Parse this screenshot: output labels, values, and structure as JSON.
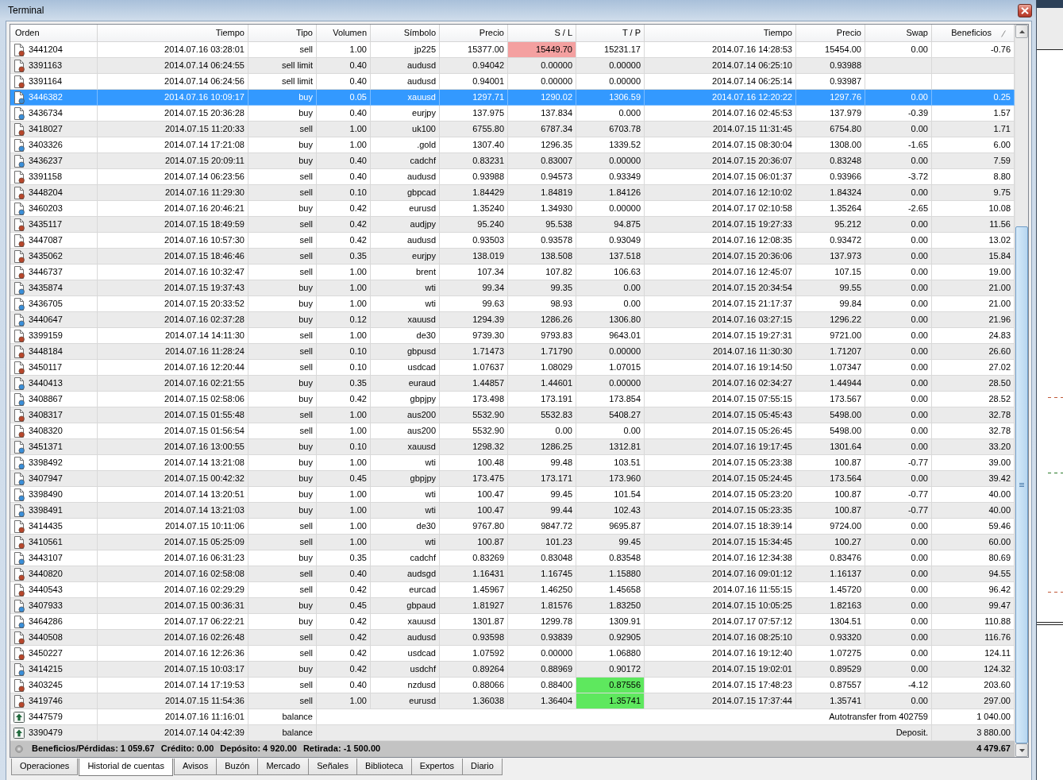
{
  "window": {
    "title": "Terminal"
  },
  "table": {
    "columns": [
      {
        "label": "Orden",
        "sorted": false
      },
      {
        "label": "Tiempo",
        "sorted": false
      },
      {
        "label": "Tipo",
        "sorted": false
      },
      {
        "label": "Volumen",
        "sorted": false
      },
      {
        "label": "Símbolo",
        "sorted": false
      },
      {
        "label": "Precio",
        "sorted": false
      },
      {
        "label": "S / L",
        "sorted": false
      },
      {
        "label": "T / P",
        "sorted": false
      },
      {
        "label": "Tiempo",
        "sorted": false
      },
      {
        "label": "Precio",
        "sorted": false
      },
      {
        "label": "Swap",
        "sorted": false
      },
      {
        "label": "Beneficios",
        "sorted": true
      }
    ],
    "rows": [
      {
        "kind": "sell",
        "selected": false,
        "order": "3441204",
        "open_time": "2014.07.16 03:28:01",
        "type": "sell",
        "volume": "1.00",
        "symbol": "jp225",
        "open_price": "15377.00",
        "sl": "15449.70",
        "sl_hit": true,
        "tp": "15231.17",
        "tp_hit": false,
        "close_time": "2014.07.16 14:28:53",
        "close_price": "15454.00",
        "swap": "0.00",
        "profit": "-0.76"
      },
      {
        "kind": "sell",
        "selected": false,
        "order": "3391163",
        "open_time": "2014.07.14 06:24:55",
        "type": "sell limit",
        "volume": "0.40",
        "symbol": "audusd",
        "open_price": "0.94042",
        "sl": "0.00000",
        "sl_hit": false,
        "tp": "0.00000",
        "tp_hit": false,
        "close_time": "2014.07.14 06:25:10",
        "close_price": "0.93988"
      },
      {
        "kind": "sell",
        "selected": false,
        "order": "3391164",
        "open_time": "2014.07.14 06:24:56",
        "type": "sell limit",
        "volume": "0.40",
        "symbol": "audusd",
        "open_price": "0.94001",
        "sl": "0.00000",
        "sl_hit": false,
        "tp": "0.00000",
        "tp_hit": false,
        "close_time": "2014.07.14 06:25:14",
        "close_price": "0.93987"
      },
      {
        "kind": "buy",
        "selected": true,
        "order": "3446382",
        "open_time": "2014.07.16 10:09:17",
        "type": "buy",
        "volume": "0.05",
        "symbol": "xauusd",
        "open_price": "1297.71",
        "sl": "1290.02",
        "sl_hit": false,
        "tp": "1306.59",
        "tp_hit": false,
        "close_time": "2014.07.16 12:20:22",
        "close_price": "1297.76",
        "swap": "0.00",
        "profit": "0.25"
      },
      {
        "kind": "buy",
        "selected": false,
        "order": "3436734",
        "open_time": "2014.07.15 20:36:28",
        "type": "buy",
        "volume": "0.40",
        "symbol": "eurjpy",
        "open_price": "137.975",
        "sl": "137.834",
        "sl_hit": false,
        "tp": "0.000",
        "tp_hit": false,
        "close_time": "2014.07.16 02:45:53",
        "close_price": "137.979",
        "swap": "-0.39",
        "profit": "1.57"
      },
      {
        "kind": "sell",
        "selected": false,
        "order": "3418027",
        "open_time": "2014.07.15 11:20:33",
        "type": "sell",
        "volume": "1.00",
        "symbol": "uk100",
        "open_price": "6755.80",
        "sl": "6787.34",
        "sl_hit": false,
        "tp": "6703.78",
        "tp_hit": false,
        "close_time": "2014.07.15 11:31:45",
        "close_price": "6754.80",
        "swap": "0.00",
        "profit": "1.71"
      },
      {
        "kind": "buy",
        "selected": false,
        "order": "3403326",
        "open_time": "2014.07.14 17:21:08",
        "type": "buy",
        "volume": "1.00",
        "symbol": ".gold",
        "open_price": "1307.40",
        "sl": "1296.35",
        "sl_hit": false,
        "tp": "1339.52",
        "tp_hit": false,
        "close_time": "2014.07.15 08:30:04",
        "close_price": "1308.00",
        "swap": "-1.65",
        "profit": "6.00"
      },
      {
        "kind": "buy",
        "selected": false,
        "order": "3436237",
        "open_time": "2014.07.15 20:09:11",
        "type": "buy",
        "volume": "0.40",
        "symbol": "cadchf",
        "open_price": "0.83231",
        "sl": "0.83007",
        "sl_hit": false,
        "tp": "0.00000",
        "tp_hit": false,
        "close_time": "2014.07.15 20:36:07",
        "close_price": "0.83248",
        "swap": "0.00",
        "profit": "7.59"
      },
      {
        "kind": "sell",
        "selected": false,
        "order": "3391158",
        "open_time": "2014.07.14 06:23:56",
        "type": "sell",
        "volume": "0.40",
        "symbol": "audusd",
        "open_price": "0.93988",
        "sl": "0.94573",
        "sl_hit": false,
        "tp": "0.93349",
        "tp_hit": false,
        "close_time": "2014.07.15 06:01:37",
        "close_price": "0.93966",
        "swap": "-3.72",
        "profit": "8.80"
      },
      {
        "kind": "sell",
        "selected": false,
        "order": "3448204",
        "open_time": "2014.07.16 11:29:30",
        "type": "sell",
        "volume": "0.10",
        "symbol": "gbpcad",
        "open_price": "1.84429",
        "sl": "1.84819",
        "sl_hit": false,
        "tp": "1.84126",
        "tp_hit": false,
        "close_time": "2014.07.16 12:10:02",
        "close_price": "1.84324",
        "swap": "0.00",
        "profit": "9.75"
      },
      {
        "kind": "buy",
        "selected": false,
        "order": "3460203",
        "open_time": "2014.07.16 20:46:21",
        "type": "buy",
        "volume": "0.42",
        "symbol": "eurusd",
        "open_price": "1.35240",
        "sl": "1.34930",
        "sl_hit": false,
        "tp": "0.00000",
        "tp_hit": false,
        "close_time": "2014.07.17 02:10:58",
        "close_price": "1.35264",
        "swap": "-2.65",
        "profit": "10.08"
      },
      {
        "kind": "sell",
        "selected": false,
        "order": "3435117",
        "open_time": "2014.07.15 18:49:59",
        "type": "sell",
        "volume": "0.42",
        "symbol": "audjpy",
        "open_price": "95.240",
        "sl": "95.538",
        "sl_hit": false,
        "tp": "94.875",
        "tp_hit": false,
        "close_time": "2014.07.15 19:27:33",
        "close_price": "95.212",
        "swap": "0.00",
        "profit": "11.56"
      },
      {
        "kind": "sell",
        "selected": false,
        "order": "3447087",
        "open_time": "2014.07.16 10:57:30",
        "type": "sell",
        "volume": "0.42",
        "symbol": "audusd",
        "open_price": "0.93503",
        "sl": "0.93578",
        "sl_hit": false,
        "tp": "0.93049",
        "tp_hit": false,
        "close_time": "2014.07.16 12:08:35",
        "close_price": "0.93472",
        "swap": "0.00",
        "profit": "13.02"
      },
      {
        "kind": "sell",
        "selected": false,
        "order": "3435062",
        "open_time": "2014.07.15 18:46:46",
        "type": "sell",
        "volume": "0.35",
        "symbol": "eurjpy",
        "open_price": "138.019",
        "sl": "138.508",
        "sl_hit": false,
        "tp": "137.518",
        "tp_hit": false,
        "close_time": "2014.07.15 20:36:06",
        "close_price": "137.973",
        "swap": "0.00",
        "profit": "15.84"
      },
      {
        "kind": "sell",
        "selected": false,
        "order": "3446737",
        "open_time": "2014.07.16 10:32:47",
        "type": "sell",
        "volume": "1.00",
        "symbol": "brent",
        "open_price": "107.34",
        "sl": "107.82",
        "sl_hit": false,
        "tp": "106.63",
        "tp_hit": false,
        "close_time": "2014.07.16 12:45:07",
        "close_price": "107.15",
        "swap": "0.00",
        "profit": "19.00"
      },
      {
        "kind": "buy",
        "selected": false,
        "order": "3435874",
        "open_time": "2014.07.15 19:37:43",
        "type": "buy",
        "volume": "1.00",
        "symbol": "wti",
        "open_price": "99.34",
        "sl": "99.35",
        "sl_hit": false,
        "tp": "0.00",
        "tp_hit": false,
        "close_time": "2014.07.15 20:34:54",
        "close_price": "99.55",
        "swap": "0.00",
        "profit": "21.00"
      },
      {
        "kind": "buy",
        "selected": false,
        "order": "3436705",
        "open_time": "2014.07.15 20:33:52",
        "type": "buy",
        "volume": "1.00",
        "symbol": "wti",
        "open_price": "99.63",
        "sl": "98.93",
        "sl_hit": false,
        "tp": "0.00",
        "tp_hit": false,
        "close_time": "2014.07.15 21:17:37",
        "close_price": "99.84",
        "swap": "0.00",
        "profit": "21.00"
      },
      {
        "kind": "buy",
        "selected": false,
        "order": "3440647",
        "open_time": "2014.07.16 02:37:28",
        "type": "buy",
        "volume": "0.12",
        "symbol": "xauusd",
        "open_price": "1294.39",
        "sl": "1286.26",
        "sl_hit": false,
        "tp": "1306.80",
        "tp_hit": false,
        "close_time": "2014.07.16 03:27:15",
        "close_price": "1296.22",
        "swap": "0.00",
        "profit": "21.96"
      },
      {
        "kind": "sell",
        "selected": false,
        "order": "3399159",
        "open_time": "2014.07.14 14:11:30",
        "type": "sell",
        "volume": "1.00",
        "symbol": "de30",
        "open_price": "9739.30",
        "sl": "9793.83",
        "sl_hit": false,
        "tp": "9643.01",
        "tp_hit": false,
        "close_time": "2014.07.15 19:27:31",
        "close_price": "9721.00",
        "swap": "0.00",
        "profit": "24.83"
      },
      {
        "kind": "sell",
        "selected": false,
        "order": "3448184",
        "open_time": "2014.07.16 11:28:24",
        "type": "sell",
        "volume": "0.10",
        "symbol": "gbpusd",
        "open_price": "1.71473",
        "sl": "1.71790",
        "sl_hit": false,
        "tp": "0.00000",
        "tp_hit": false,
        "close_time": "2014.07.16 11:30:30",
        "close_price": "1.71207",
        "swap": "0.00",
        "profit": "26.60"
      },
      {
        "kind": "sell",
        "selected": false,
        "order": "3450117",
        "open_time": "2014.07.16 12:20:44",
        "type": "sell",
        "volume": "0.10",
        "symbol": "usdcad",
        "open_price": "1.07637",
        "sl": "1.08029",
        "sl_hit": false,
        "tp": "1.07015",
        "tp_hit": false,
        "close_time": "2014.07.16 19:14:50",
        "close_price": "1.07347",
        "swap": "0.00",
        "profit": "27.02"
      },
      {
        "kind": "buy",
        "selected": false,
        "order": "3440413",
        "open_time": "2014.07.16 02:21:55",
        "type": "buy",
        "volume": "0.35",
        "symbol": "euraud",
        "open_price": "1.44857",
        "sl": "1.44601",
        "sl_hit": false,
        "tp": "0.00000",
        "tp_hit": false,
        "close_time": "2014.07.16 02:34:27",
        "close_price": "1.44944",
        "swap": "0.00",
        "profit": "28.50"
      },
      {
        "kind": "buy",
        "selected": false,
        "order": "3408867",
        "open_time": "2014.07.15 02:58:06",
        "type": "buy",
        "volume": "0.42",
        "symbol": "gbpjpy",
        "open_price": "173.498",
        "sl": "173.191",
        "sl_hit": false,
        "tp": "173.854",
        "tp_hit": false,
        "close_time": "2014.07.15 07:55:15",
        "close_price": "173.567",
        "swap": "0.00",
        "profit": "28.52"
      },
      {
        "kind": "sell",
        "selected": false,
        "order": "3408317",
        "open_time": "2014.07.15 01:55:48",
        "type": "sell",
        "volume": "1.00",
        "symbol": "aus200",
        "open_price": "5532.90",
        "sl": "5532.83",
        "sl_hit": false,
        "tp": "5408.27",
        "tp_hit": false,
        "close_time": "2014.07.15 05:45:43",
        "close_price": "5498.00",
        "swap": "0.00",
        "profit": "32.78"
      },
      {
        "kind": "sell",
        "selected": false,
        "order": "3408320",
        "open_time": "2014.07.15 01:56:54",
        "type": "sell",
        "volume": "1.00",
        "symbol": "aus200",
        "open_price": "5532.90",
        "sl": "0.00",
        "sl_hit": false,
        "tp": "0.00",
        "tp_hit": false,
        "close_time": "2014.07.15 05:26:45",
        "close_price": "5498.00",
        "swap": "0.00",
        "profit": "32.78"
      },
      {
        "kind": "buy",
        "selected": false,
        "order": "3451371",
        "open_time": "2014.07.16 13:00:55",
        "type": "buy",
        "volume": "0.10",
        "symbol": "xauusd",
        "open_price": "1298.32",
        "sl": "1286.25",
        "sl_hit": false,
        "tp": "1312.81",
        "tp_hit": false,
        "close_time": "2014.07.16 19:17:45",
        "close_price": "1301.64",
        "swap": "0.00",
        "profit": "33.20"
      },
      {
        "kind": "buy",
        "selected": false,
        "order": "3398492",
        "open_time": "2014.07.14 13:21:08",
        "type": "buy",
        "volume": "1.00",
        "symbol": "wti",
        "open_price": "100.48",
        "sl": "99.48",
        "sl_hit": false,
        "tp": "103.51",
        "tp_hit": false,
        "close_time": "2014.07.15 05:23:38",
        "close_price": "100.87",
        "swap": "-0.77",
        "profit": "39.00"
      },
      {
        "kind": "buy",
        "selected": false,
        "order": "3407947",
        "open_time": "2014.07.15 00:42:32",
        "type": "buy",
        "volume": "0.45",
        "symbol": "gbpjpy",
        "open_price": "173.475",
        "sl": "173.171",
        "sl_hit": false,
        "tp": "173.960",
        "tp_hit": false,
        "close_time": "2014.07.15 05:24:45",
        "close_price": "173.564",
        "swap": "0.00",
        "profit": "39.42"
      },
      {
        "kind": "buy",
        "selected": false,
        "order": "3398490",
        "open_time": "2014.07.14 13:20:51",
        "type": "buy",
        "volume": "1.00",
        "symbol": "wti",
        "open_price": "100.47",
        "sl": "99.45",
        "sl_hit": false,
        "tp": "101.54",
        "tp_hit": false,
        "close_time": "2014.07.15 05:23:20",
        "close_price": "100.87",
        "swap": "-0.77",
        "profit": "40.00"
      },
      {
        "kind": "buy",
        "selected": false,
        "order": "3398491",
        "open_time": "2014.07.14 13:21:03",
        "type": "buy",
        "volume": "1.00",
        "symbol": "wti",
        "open_price": "100.47",
        "sl": "99.44",
        "sl_hit": false,
        "tp": "102.43",
        "tp_hit": false,
        "close_time": "2014.07.15 05:23:35",
        "close_price": "100.87",
        "swap": "-0.77",
        "profit": "40.00"
      },
      {
        "kind": "sell",
        "selected": false,
        "order": "3414435",
        "open_time": "2014.07.15 10:11:06",
        "type": "sell",
        "volume": "1.00",
        "symbol": "de30",
        "open_price": "9767.80",
        "sl": "9847.72",
        "sl_hit": false,
        "tp": "9695.87",
        "tp_hit": false,
        "close_time": "2014.07.15 18:39:14",
        "close_price": "9724.00",
        "swap": "0.00",
        "profit": "59.46"
      },
      {
        "kind": "sell",
        "selected": false,
        "order": "3410561",
        "open_time": "2014.07.15 05:25:09",
        "type": "sell",
        "volume": "1.00",
        "symbol": "wti",
        "open_price": "100.87",
        "sl": "101.23",
        "sl_hit": false,
        "tp": "99.45",
        "tp_hit": false,
        "close_time": "2014.07.15 15:34:45",
        "close_price": "100.27",
        "swap": "0.00",
        "profit": "60.00"
      },
      {
        "kind": "buy",
        "selected": false,
        "order": "3443107",
        "open_time": "2014.07.16 06:31:23",
        "type": "buy",
        "volume": "0.35",
        "symbol": "cadchf",
        "open_price": "0.83269",
        "sl": "0.83048",
        "sl_hit": false,
        "tp": "0.83548",
        "tp_hit": false,
        "close_time": "2014.07.16 12:34:38",
        "close_price": "0.83476",
        "swap": "0.00",
        "profit": "80.69"
      },
      {
        "kind": "sell",
        "selected": false,
        "order": "3440820",
        "open_time": "2014.07.16 02:58:08",
        "type": "sell",
        "volume": "0.40",
        "symbol": "audsgd",
        "open_price": "1.16431",
        "sl": "1.16745",
        "sl_hit": false,
        "tp": "1.15880",
        "tp_hit": false,
        "close_time": "2014.07.16 09:01:12",
        "close_price": "1.16137",
        "swap": "0.00",
        "profit": "94.55"
      },
      {
        "kind": "sell",
        "selected": false,
        "order": "3440543",
        "open_time": "2014.07.16 02:29:29",
        "type": "sell",
        "volume": "0.42",
        "symbol": "eurcad",
        "open_price": "1.45967",
        "sl": "1.46250",
        "sl_hit": false,
        "tp": "1.45658",
        "tp_hit": false,
        "close_time": "2014.07.16 11:55:15",
        "close_price": "1.45720",
        "swap": "0.00",
        "profit": "96.42"
      },
      {
        "kind": "buy",
        "selected": false,
        "order": "3407933",
        "open_time": "2014.07.15 00:36:31",
        "type": "buy",
        "volume": "0.45",
        "symbol": "gbpaud",
        "open_price": "1.81927",
        "sl": "1.81576",
        "sl_hit": false,
        "tp": "1.83250",
        "tp_hit": false,
        "close_time": "2014.07.15 10:05:25",
        "close_price": "1.82163",
        "swap": "0.00",
        "profit": "99.47"
      },
      {
        "kind": "buy",
        "selected": false,
        "order": "3464286",
        "open_time": "2014.07.17 06:22:21",
        "type": "buy",
        "volume": "0.42",
        "symbol": "xauusd",
        "open_price": "1301.87",
        "sl": "1299.78",
        "sl_hit": false,
        "tp": "1309.91",
        "tp_hit": false,
        "close_time": "2014.07.17 07:57:12",
        "close_price": "1304.51",
        "swap": "0.00",
        "profit": "110.88"
      },
      {
        "kind": "sell",
        "selected": false,
        "order": "3440508",
        "open_time": "2014.07.16 02:26:48",
        "type": "sell",
        "volume": "0.42",
        "symbol": "audusd",
        "open_price": "0.93598",
        "sl": "0.93839",
        "sl_hit": false,
        "tp": "0.92905",
        "tp_hit": false,
        "close_time": "2014.07.16 08:25:10",
        "close_price": "0.93320",
        "swap": "0.00",
        "profit": "116.76"
      },
      {
        "kind": "sell",
        "selected": false,
        "order": "3450227",
        "open_time": "2014.07.16 12:26:36",
        "type": "sell",
        "volume": "0.42",
        "symbol": "usdcad",
        "open_price": "1.07592",
        "sl": "0.00000",
        "sl_hit": false,
        "tp": "1.06880",
        "tp_hit": false,
        "close_time": "2014.07.16 19:12:40",
        "close_price": "1.07275",
        "swap": "0.00",
        "profit": "124.11"
      },
      {
        "kind": "buy",
        "selected": false,
        "order": "3414215",
        "open_time": "2014.07.15 10:03:17",
        "type": "buy",
        "volume": "0.42",
        "symbol": "usdchf",
        "open_price": "0.89264",
        "sl": "0.88969",
        "sl_hit": false,
        "tp": "0.90172",
        "tp_hit": false,
        "close_time": "2014.07.15 19:02:01",
        "close_price": "0.89529",
        "swap": "0.00",
        "profit": "124.32"
      },
      {
        "kind": "sell",
        "selected": false,
        "order": "3403245",
        "open_time": "2014.07.14 17:19:53",
        "type": "sell",
        "volume": "0.40",
        "symbol": "nzdusd",
        "open_price": "0.88066",
        "sl": "0.88400",
        "sl_hit": false,
        "tp": "0.87556",
        "tp_hit": true,
        "close_time": "2014.07.15 17:48:23",
        "close_price": "0.87557",
        "swap": "-4.12",
        "profit": "203.60"
      },
      {
        "kind": "sell",
        "selected": false,
        "order": "3419746",
        "open_time": "2014.07.15 11:54:36",
        "type": "sell",
        "volume": "1.00",
        "symbol": "eurusd",
        "open_price": "1.36038",
        "sl": "1.36404",
        "sl_hit": false,
        "tp": "1.35741",
        "tp_hit": true,
        "close_time": "2014.07.15 17:37:44",
        "close_price": "1.35741",
        "swap": "0.00",
        "profit": "297.00"
      },
      {
        "kind": "balance",
        "selected": false,
        "order": "3447579",
        "open_time": "2014.07.16 11:16:01",
        "type": "balance",
        "comment": "Autotransfer from 402759",
        "profit": "1 040.00"
      },
      {
        "kind": "balance",
        "selected": false,
        "order": "3390479",
        "open_time": "2014.07.14 04:42:39",
        "type": "balance",
        "comment": "Deposit.",
        "profit": "3 880.00"
      }
    ]
  },
  "summary": {
    "items": [
      "Beneficios/Pérdidas: 1 059.67",
      "Crédito: 0.00",
      "Depósito: 4 920.00",
      "Retirada: -1 500.00"
    ],
    "total": "4 479.67"
  },
  "tabs": [
    {
      "label": "Operaciones",
      "selected": false
    },
    {
      "label": "Historial de cuentas",
      "selected": true
    },
    {
      "label": "Avisos",
      "selected": false
    },
    {
      "label": "Buzón",
      "selected": false
    },
    {
      "label": "Mercado",
      "selected": false
    },
    {
      "label": "Señales",
      "selected": false
    },
    {
      "label": "Biblioteca",
      "selected": false
    },
    {
      "label": "Expertos",
      "selected": false
    },
    {
      "label": "Diario",
      "selected": false
    }
  ]
}
